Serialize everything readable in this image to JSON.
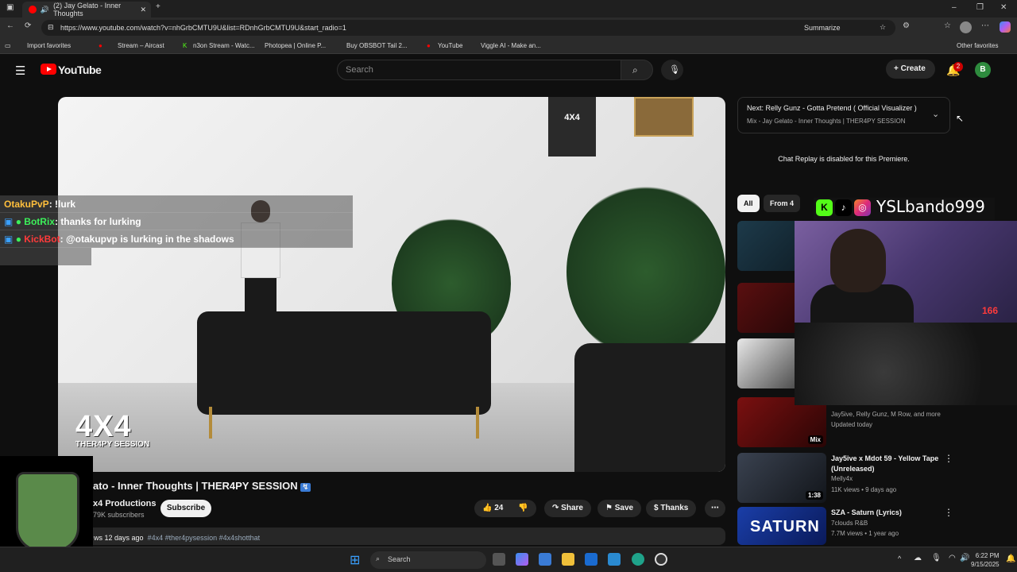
{
  "browser": {
    "tab_title": "(2) Jay Gelato - Inner Thoughts",
    "url": "https://www.youtube.com/watch?v=nhGrbCMTU9U&list=RDnhGrbCMTU9U&start_radio=1",
    "summarize_label": "Summarize",
    "bookmarks": [
      "Import favorites",
      "Stream – Aircast",
      "n3on Stream - Watc...",
      "Photopea | Online P...",
      "Buy OBSBOT Tail 2...",
      "YouTube",
      "Viggle AI - Make an..."
    ],
    "other_favorites": "Other favorites"
  },
  "youtube": {
    "logo_text": "YouTube",
    "search_placeholder": "Search",
    "create_label": "Create",
    "notification_count": "2",
    "avatar_letter": "B"
  },
  "video": {
    "watermark_4x4": "4X4",
    "watermark_session": "THER4PY SESSION",
    "banner_text": "4X4",
    "title": "ato - Inner Thoughts | THER4PY SESSION",
    "channel": "x4 Productions",
    "subscribers": "79K subscribers",
    "subscribe_label": "Subscribe",
    "likes": "24",
    "share_label": "Share",
    "save_label": "Save",
    "thanks_label": "Thanks",
    "desc_meta": "ws  12 days ago",
    "desc_tags": "#4x4 #ther4pysession #4x4shotthat"
  },
  "chat_overlay": [
    {
      "user": "OtakuPvP",
      "msg": ": !lurk"
    },
    {
      "user": "BotRix",
      "msg": ": thanks for lurking"
    },
    {
      "user": "KickBot",
      "msg": ": @otakupvp is lurking in the shadows"
    }
  ],
  "sidebar": {
    "next_title": "Next: Relly Gunz - Gotta Pretend ( Official Visualizer )",
    "next_sub": "Mix - Jay Gelato - Inner Thoughts | THER4PY SESSION",
    "chat_replay": "Chat Replay is disabled for this Premiere.",
    "chips": [
      "All",
      "From 4"
    ],
    "mix_badge": "Mix",
    "items": [
      {
        "title": "",
        "meta1": "Jay5ive, Relly Gunz, M Row, and more",
        "meta2": "Updated today"
      },
      {
        "title": "Jay5ive x Mdot 59 - Yellow Tape (Unreleased)",
        "meta1": "Melly4x",
        "meta2": "11K views • 9 days ago",
        "duration": "1:38"
      },
      {
        "title": "SZA - Saturn (Lyrics)",
        "meta1": "7clouds R&B",
        "meta2": "7.7M views • 1 year ago"
      }
    ]
  },
  "stream_overlay": {
    "handle": "YSLbando999",
    "kick_count": "166"
  },
  "taskbar": {
    "search_label": "Search",
    "time": "6:22 PM",
    "date": "9/15/2025"
  },
  "colors": {
    "youtube_red": "#ff0000",
    "bg": "#0f0f0f",
    "chat_user_1": "#ffbf3c",
    "chat_user_2": "#3cf05a",
    "chat_user_3": "#ff3b3b"
  }
}
